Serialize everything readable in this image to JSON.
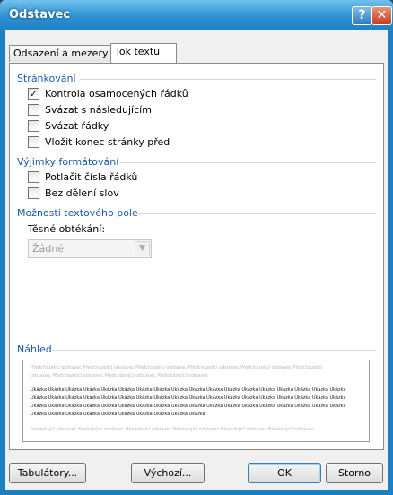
{
  "window": {
    "title": "Odstavec"
  },
  "title_buttons": {
    "help": "?",
    "close": "✕"
  },
  "tabs": [
    {
      "label": "Odsazení a mezery",
      "active": false
    },
    {
      "label": "Tok textu",
      "active": true
    }
  ],
  "sections": {
    "pagination": {
      "title": "Stránkování",
      "options": [
        {
          "label": "Kontrola osamocených řádků",
          "checked": true
        },
        {
          "label": "Svázat s následujícím",
          "checked": false
        },
        {
          "label": "Svázat řádky",
          "checked": false
        },
        {
          "label": "Vložit konec stránky před",
          "checked": false
        }
      ]
    },
    "exceptions": {
      "title": "Výjimky formátování",
      "options": [
        {
          "label": "Potlačit čísla řádků",
          "checked": false
        },
        {
          "label": "Bez dělení slov",
          "checked": false
        }
      ]
    },
    "textbox": {
      "title": "Možnosti textového pole",
      "tight_wrap_label": "Těsné obtékání:",
      "tight_wrap_value": "Žádné"
    },
    "preview": {
      "title": "Náhled",
      "prev_line1": "Předcházející odstavec Předcházející odstavec Předcházející odstavec Předcházející odstavec Předcházející odstavec Předcházející",
      "prev_line2": "odstavec Předcházející odstavec Předcházející odstavec Předcházející odstavec",
      "sample_line1": "Ukázka Ukázka Ukázka Ukázka Ukázka Ukázka Ukázka Ukázka Ukázka Ukázka Ukázka Ukázka Ukázka Ukázka Ukázka Ukázka Ukázka Ukázka",
      "sample_line2": "Ukázka Ukázka Ukázka Ukázka Ukázka Ukázka Ukázka Ukázka Ukázka Ukázka Ukázka Ukázka Ukázka Ukázka Ukázka Ukázka Ukázka Ukázka",
      "sample_line3": "Ukázka Ukázka Ukázka Ukázka Ukázka Ukázka Ukázka Ukázka Ukázka Ukázka Ukázka Ukázka Ukázka Ukázka Ukázka Ukázka Ukázka Ukázka",
      "sample_line4": "Ukázka Ukázka Ukázka Ukázka Ukázka Ukázka Ukázka Ukázka Ukázka Ukázka",
      "next_line1": "Následující odstavec Následující odstavec Následující odstavec Následující odstavec Následující odstavec Následující odstavec"
    }
  },
  "buttons": {
    "tabs": "Tabulátory...",
    "default": "Výchozí...",
    "ok": "OK",
    "cancel": "Storno"
  },
  "colors": {
    "section_title": "#1c5aa8",
    "titlebar": "#2f92d2"
  }
}
